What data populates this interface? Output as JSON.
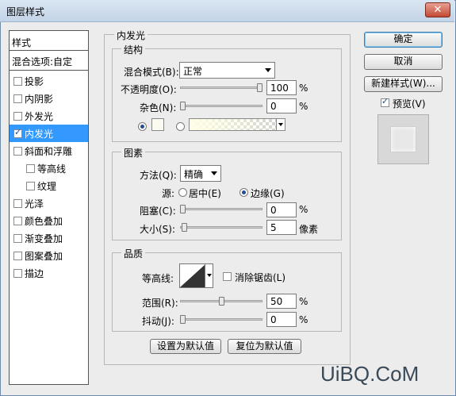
{
  "window": {
    "title": "图层样式",
    "close_glyph": "✕"
  },
  "styles_panel": {
    "header": "样式",
    "blend_options": "混合选项:自定",
    "items": [
      {
        "label": "投影",
        "checked": false,
        "selected": false,
        "indent": false
      },
      {
        "label": "内阴影",
        "checked": false,
        "selected": false,
        "indent": false
      },
      {
        "label": "外发光",
        "checked": false,
        "selected": false,
        "indent": false
      },
      {
        "label": "内发光",
        "checked": true,
        "selected": true,
        "indent": false
      },
      {
        "label": "斜面和浮雕",
        "checked": false,
        "selected": false,
        "indent": false
      },
      {
        "label": "等高线",
        "checked": false,
        "selected": false,
        "indent": true
      },
      {
        "label": "纹理",
        "checked": false,
        "selected": false,
        "indent": true
      },
      {
        "label": "光泽",
        "checked": false,
        "selected": false,
        "indent": false
      },
      {
        "label": "颜色叠加",
        "checked": false,
        "selected": false,
        "indent": false
      },
      {
        "label": "渐变叠加",
        "checked": false,
        "selected": false,
        "indent": false
      },
      {
        "label": "图案叠加",
        "checked": false,
        "selected": false,
        "indent": false
      },
      {
        "label": "描边",
        "checked": false,
        "selected": false,
        "indent": false
      }
    ]
  },
  "inner_glow": {
    "title": "内发光",
    "structure": {
      "title": "结构",
      "blend_mode_label": "混合模式(B):",
      "blend_mode_value": "正常",
      "opacity_label": "不透明度(O):",
      "opacity_value": "100",
      "opacity_unit": "%",
      "opacity_level": 1.0,
      "noise_label": "杂色(N):",
      "noise_value": "0",
      "noise_unit": "%",
      "noise_level": 0.0
    },
    "elements": {
      "title": "图素",
      "technique_label": "方法(Q):",
      "technique_value": "精确",
      "source_label": "源:",
      "source_center": "居中(E)",
      "source_edge": "边缘(G)",
      "choke_label": "阻塞(C):",
      "choke_value": "0",
      "choke_unit": "%",
      "choke_level": 0.0,
      "size_label": "大小(S):",
      "size_value": "5",
      "size_unit": "像素",
      "size_level": 0.02
    },
    "quality": {
      "title": "品质",
      "contour_label": "等高线:",
      "anti_alias_label": "消除锯齿(L)",
      "range_label": "范围(R):",
      "range_value": "50",
      "range_unit": "%",
      "range_level": 0.5,
      "jitter_label": "抖动(J):",
      "jitter_value": "0",
      "jitter_unit": "%",
      "jitter_level": 0.0
    },
    "make_default": "设置为默认值",
    "reset_default": "复位为默认值"
  },
  "buttons": {
    "ok": "确定",
    "cancel": "取消",
    "new_style": "新建样式(W)...",
    "preview_label": "预览(V)"
  },
  "watermark": "UiBQ.CoM"
}
